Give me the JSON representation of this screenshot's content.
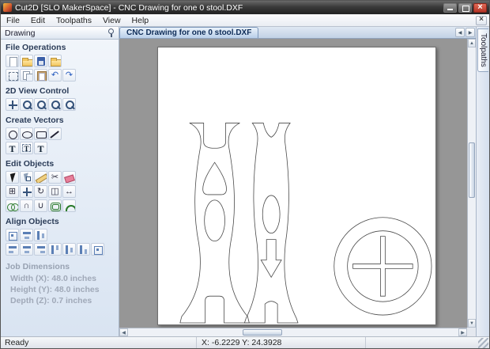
{
  "window": {
    "title": "Cut2D [SLO MakerSpace] - CNC Drawing for one 0 stool.DXF"
  },
  "menu": [
    "File",
    "Edit",
    "Toolpaths",
    "View",
    "Help"
  ],
  "panel": {
    "title": "Drawing",
    "sections": [
      {
        "label": "File Operations",
        "rows": [
          [
            {
              "n": "new-file",
              "c": "page"
            },
            {
              "n": "open-file",
              "c": "folder"
            },
            {
              "n": "save-file",
              "c": "save"
            },
            {
              "n": "import-file",
              "c": "folder"
            }
          ],
          [
            {
              "n": "export-selection",
              "c": "import"
            },
            {
              "n": "copy",
              "c": "copy"
            },
            {
              "n": "paste",
              "c": "paste"
            },
            {
              "n": "undo",
              "g": "↶",
              "c": "blue"
            },
            {
              "n": "redo",
              "g": "↷",
              "c": "blue"
            }
          ]
        ]
      },
      {
        "label": "2D View Control",
        "rows": [
          [
            {
              "n": "pan-view",
              "c": "move"
            },
            {
              "n": "zoom-interactive",
              "c": "zoom"
            },
            {
              "n": "zoom-window",
              "c": "zoom"
            },
            {
              "n": "zoom-extents",
              "c": "zoom"
            },
            {
              "n": "zoom-selection",
              "c": "zoom"
            }
          ]
        ]
      },
      {
        "label": "Create Vectors",
        "rows": [
          [
            {
              "n": "draw-circle",
              "c": "circle"
            },
            {
              "n": "draw-ellipse",
              "c": "ellipse"
            },
            {
              "n": "draw-rectangle",
              "c": "rect"
            },
            {
              "n": "draw-polyline",
              "c": "polyline"
            }
          ],
          [
            {
              "n": "draw-text",
              "c": "text"
            },
            {
              "n": "draw-text-box",
              "c": "textbox"
            },
            {
              "n": "text-on-curve",
              "c": "text"
            }
          ]
        ]
      },
      {
        "label": "Edit Objects",
        "rows": [
          [
            {
              "n": "select-objects",
              "c": "cursor"
            },
            {
              "n": "node-editing",
              "c": "cursor2"
            },
            {
              "n": "measure-tool",
              "c": "ruler"
            },
            {
              "n": "trim-vectors",
              "g": "✂"
            },
            {
              "n": "erase-tool",
              "c": "eraser"
            }
          ],
          [
            {
              "n": "snap-grid",
              "g": "⊞"
            },
            {
              "n": "move-selection",
              "c": "move"
            },
            {
              "n": "rotate-selection",
              "g": "↻"
            },
            {
              "n": "mirror-selection",
              "g": "◫"
            },
            {
              "n": "scale-selection",
              "g": "↔"
            }
          ],
          [
            {
              "n": "weld-vectors",
              "c": "weld"
            },
            {
              "n": "subtract-vectors",
              "g": "∩"
            },
            {
              "n": "join-vectors",
              "g": "∪"
            },
            {
              "n": "offset-vectors",
              "c": "offset"
            },
            {
              "n": "fillet-corners",
              "c": "arc"
            }
          ]
        ]
      },
      {
        "label": "Align Objects",
        "rows": [
          [
            {
              "n": "center-in-material",
              "c": "aligncc"
            },
            {
              "n": "center-horizontal",
              "c": "alignC"
            },
            {
              "n": "center-vertical",
              "c": "alignM"
            }
          ],
          [
            {
              "n": "align-left",
              "c": "alignL"
            },
            {
              "n": "align-center",
              "c": "alignC"
            },
            {
              "n": "align-right",
              "c": "alignR"
            },
            {
              "n": "align-top",
              "c": "alignT"
            },
            {
              "n": "align-middle",
              "c": "alignM"
            },
            {
              "n": "align-bottom",
              "c": "alignB"
            },
            {
              "n": "align-spread",
              "c": "aligncc"
            }
          ]
        ]
      }
    ],
    "job": {
      "title": "Job Dimensions",
      "lines": [
        "Width (X): 48.0 inches",
        "Height (Y): 48.0 inches",
        "Depth (Z): 0.7 inches"
      ]
    }
  },
  "document": {
    "tab": "CNC Drawing for one 0 stool.DXF"
  },
  "right_tab": "Toolpaths",
  "status": {
    "text": "Ready",
    "coords": "X: -6.2229 Y: 24.3928"
  },
  "colors": {
    "accent": "#3b6ea5",
    "canvas_gray": "#969696",
    "close_red": "#b63527",
    "sheet_white": "#ffffff"
  }
}
